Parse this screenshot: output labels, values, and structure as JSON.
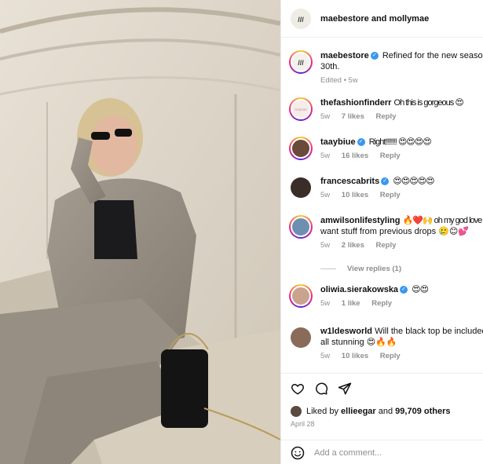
{
  "header": {
    "user1": "maebestore",
    "and": "and",
    "user2": "mollymae"
  },
  "comments": [
    {
      "user": "maebestore",
      "verified": true,
      "text": "Refined for the new season",
      "text2": "30th.",
      "meta_time": "Edited • 5w",
      "avatar": "maebe-logo",
      "ring": true
    },
    {
      "user": "thefashionfinderr",
      "verified": false,
      "text": "Oh this is gorgeous 😍",
      "time": "5w",
      "likes": "7 likes",
      "reply": "Reply",
      "avatar": "fashionfinderr-logo",
      "ring": true
    },
    {
      "user": "taaybiue",
      "verified": true,
      "text": "Right!!!!!!! 😍😍😍😍",
      "time": "5w",
      "likes": "16 likes",
      "reply": "Reply",
      "avatar": "person",
      "ring": true
    },
    {
      "user": "francescabrits",
      "verified": true,
      "text": "😍😍😍😍😍",
      "time": "5w",
      "likes": "10 likes",
      "reply": "Reply",
      "avatar": "person",
      "ring": false
    },
    {
      "user": "amwilsonlifestyling",
      "verified": false,
      "text": "🔥❤️🙌 oh my god love",
      "text2": "want stuff from previous drops 🥲😊💕",
      "time": "5w",
      "likes": "2 likes",
      "reply": "Reply",
      "avatar": "person",
      "ring": true
    },
    {
      "user": "oliwia.sierakowska",
      "verified": true,
      "text": "😍😍",
      "time": "5w",
      "likes": "1 like",
      "reply": "Reply",
      "avatar": "person",
      "ring": true
    },
    {
      "user": "w1ldesworld",
      "verified": false,
      "text": "Will the black top be included",
      "text2": "all stunning 😍🔥🔥",
      "time": "5w",
      "likes": "10 likes",
      "reply": "Reply",
      "avatar": "person",
      "ring": false
    }
  ],
  "view_replies": "View replies (1)",
  "likes": {
    "prefix": "Liked by",
    "user": "ellieegar",
    "and": "and",
    "count": "99,709 others"
  },
  "date": "April 28",
  "add_comment": {
    "placeholder": "Add a comment..."
  }
}
